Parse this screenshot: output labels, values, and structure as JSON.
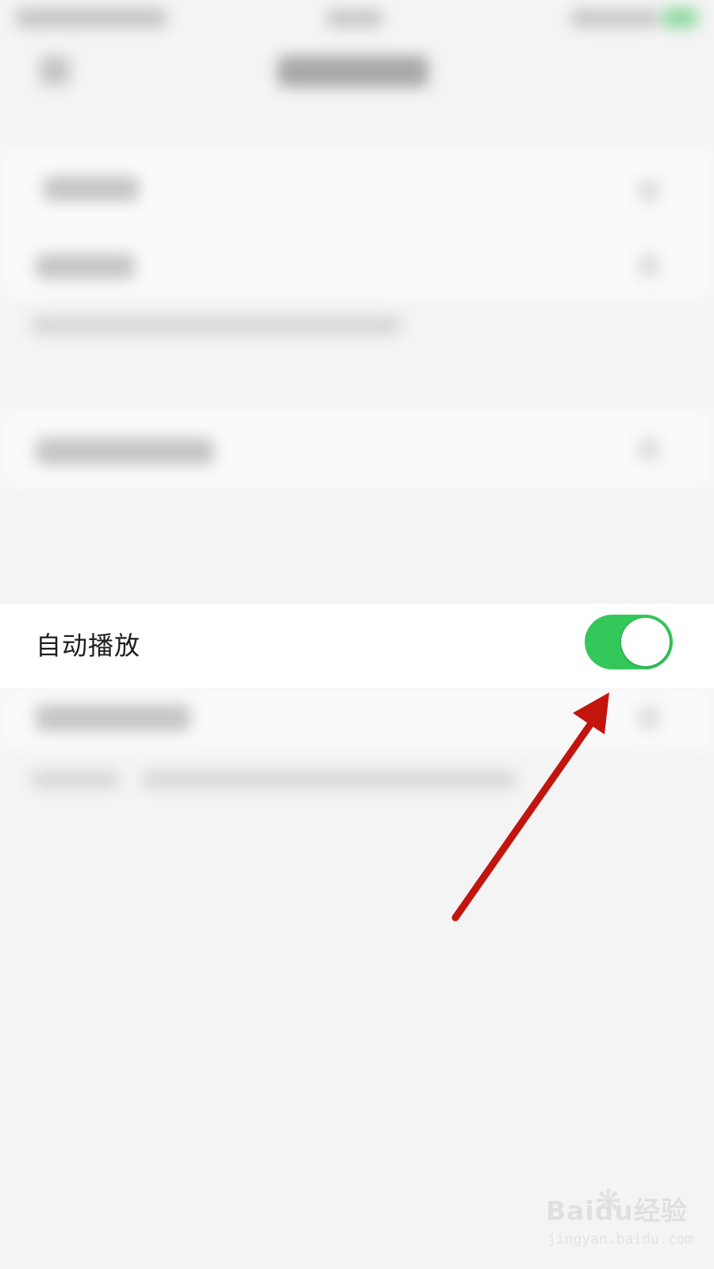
{
  "settings": {
    "autoplay_label": "自动播放",
    "autoplay_enabled": true
  },
  "colors": {
    "toggle_on": "#34c759",
    "annotation_arrow": "#c2150e"
  },
  "watermark": {
    "main": "Baidu经验",
    "sub": "jingyan.baidu.com"
  },
  "icons": {
    "paw": "baidu-paw-icon"
  }
}
